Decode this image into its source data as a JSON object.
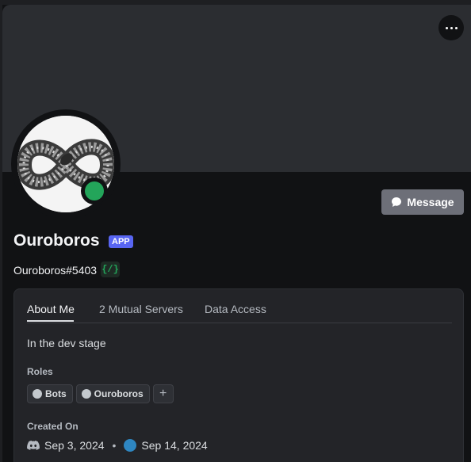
{
  "header": {
    "more_icon": "more-horizontal-icon",
    "message_button_label": "Message",
    "message_icon": "speech-bubble-icon"
  },
  "profile": {
    "display_name": "Ouroboros",
    "app_tag": "APP",
    "username": "Ouroboros#5403",
    "command_badge": "{/}",
    "status_color": "#23a55a",
    "avatar": "ouroboros-snake-avatar"
  },
  "tabs": [
    {
      "label": "About Me",
      "active": true
    },
    {
      "label": "2 Mutual Servers",
      "active": false
    },
    {
      "label": "Data Access",
      "active": false
    }
  ],
  "about": {
    "bio": "In the dev stage",
    "roles_label": "Roles",
    "roles": [
      {
        "name": "Bots"
      },
      {
        "name": "Ouroboros"
      }
    ],
    "add_role_icon": "plus-icon",
    "created_label": "Created On",
    "created_discord": "Sep 3, 2024",
    "separator": "•",
    "created_server": "Sep 14, 2024"
  },
  "colors": {
    "accent": "#5865f2",
    "online": "#23a55a",
    "message_button": "#6d6f78"
  }
}
